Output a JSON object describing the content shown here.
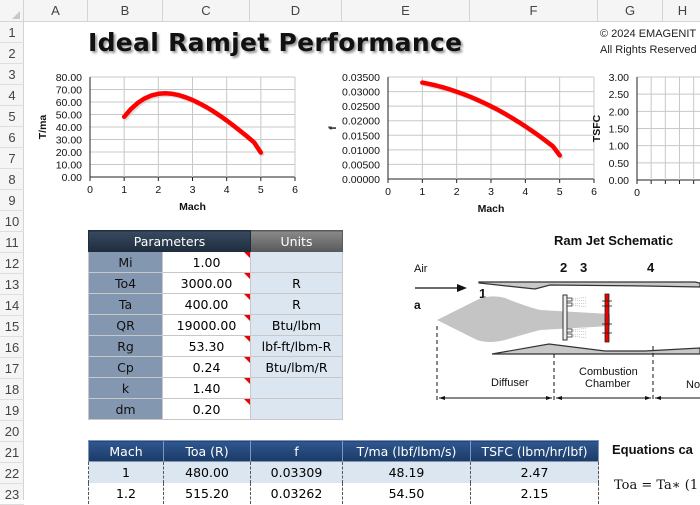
{
  "spreadsheet": {
    "columns": [
      "A",
      "B",
      "C",
      "D",
      "E",
      "F",
      "G",
      "H"
    ],
    "rows": [
      "1",
      "2",
      "3",
      "4",
      "5",
      "6",
      "7",
      "8",
      "9",
      "10",
      "11",
      "12",
      "13",
      "14",
      "15",
      "16",
      "17",
      "18",
      "19",
      "20",
      "21",
      "22",
      "23"
    ]
  },
  "header": {
    "title": "Ideal Ramjet Performance",
    "copyright_line1": "© 2024 EMAGENIT",
    "copyright_line2": "All Rights Reserved"
  },
  "parameters": {
    "header_params": "Parameters",
    "header_units": "Units",
    "rows": [
      {
        "name": "Mi",
        "value": "1.00",
        "unit": ""
      },
      {
        "name": "To4",
        "value": "3000.00",
        "unit": "R"
      },
      {
        "name": "Ta",
        "value": "400.00",
        "unit": "R"
      },
      {
        "name": "QR",
        "value": "19000.00",
        "unit": "Btu/lbm"
      },
      {
        "name": "Rg",
        "value": "53.30",
        "unit": "lbf-ft/lbm-R"
      },
      {
        "name": "Cp",
        "value": "0.24",
        "unit": "Btu/lbm/R"
      },
      {
        "name": "k",
        "value": "1.40",
        "unit": ""
      },
      {
        "name": "dm",
        "value": "0.20",
        "unit": ""
      }
    ]
  },
  "schematic": {
    "title": "Ram Jet Schematic",
    "air_label": "Air",
    "a_label": "a",
    "station_1": "1",
    "station_2": "2",
    "station_3": "3",
    "station_4": "4",
    "diffuser_label": "Diffuser",
    "combustion_label_1": "Combustion",
    "combustion_label_2": "Chamber",
    "nozzle_label": "No"
  },
  "results": {
    "headers": [
      "Mach",
      "Toa (R)",
      "f",
      "T/ma (lbf/lbm/s)",
      "TSFC (lbm/hr/lbf)"
    ],
    "rows": [
      [
        "1",
        "480.00",
        "0.03309",
        "48.19",
        "2.47"
      ],
      [
        "1.2",
        "515.20",
        "0.03262",
        "54.50",
        "2.15"
      ]
    ]
  },
  "equations": {
    "title": "Equations ca",
    "line1": "Toa  = Ta∗ (1"
  },
  "chart_data": [
    {
      "type": "line",
      "title": "",
      "xlabel": "Mach",
      "ylabel": "T/ma",
      "xlim": [
        0,
        6
      ],
      "ylim": [
        0,
        80
      ],
      "xticks": [
        "0",
        "1",
        "2",
        "3",
        "4",
        "5",
        "6"
      ],
      "yticks": [
        "0.00",
        "10.00",
        "20.00",
        "30.00",
        "40.00",
        "50.00",
        "60.00",
        "70.00",
        "80.00"
      ],
      "grid": true,
      "color": "#ff0000",
      "x": [
        1,
        1.2,
        1.4,
        1.6,
        1.8,
        2.0,
        2.2,
        2.4,
        2.6,
        2.8,
        3.0,
        3.2,
        3.4,
        3.6,
        3.8,
        4.0,
        4.2,
        4.4,
        4.6,
        4.8,
        5.0
      ],
      "y": [
        48.19,
        54.5,
        59.3,
        62.9,
        65.3,
        66.6,
        67.0,
        66.6,
        65.5,
        63.8,
        61.6,
        59.0,
        56.0,
        52.7,
        49.1,
        45.2,
        41.1,
        36.8,
        32.4,
        27.8,
        19.5
      ]
    },
    {
      "type": "line",
      "title": "",
      "xlabel": "Mach",
      "ylabel": "f",
      "xlim": [
        0,
        6
      ],
      "ylim": [
        0,
        0.035
      ],
      "xticks": [
        "0",
        "1",
        "2",
        "3",
        "4",
        "5",
        "6"
      ],
      "yticks": [
        "0.00000",
        "0.00500",
        "0.01000",
        "0.01500",
        "0.02000",
        "0.02500",
        "0.03000",
        "0.03500"
      ],
      "grid": true,
      "color": "#ff0000",
      "x": [
        1,
        1.2,
        1.4,
        1.6,
        1.8,
        2.0,
        2.2,
        2.4,
        2.6,
        2.8,
        3.0,
        3.2,
        3.4,
        3.6,
        3.8,
        4.0,
        4.2,
        4.4,
        4.6,
        4.8,
        5.0
      ],
      "y": [
        0.03309,
        0.03262,
        0.03207,
        0.03145,
        0.03075,
        0.02997,
        0.02912,
        0.02819,
        0.02719,
        0.02611,
        0.02496,
        0.02373,
        0.02243,
        0.02105,
        0.0196,
        0.01808,
        0.01648,
        0.01481,
        0.01307,
        0.01125,
        0.0081
      ]
    },
    {
      "type": "line",
      "title": "",
      "xlabel": "",
      "ylabel": "TSFC",
      "xlim": [
        0,
        6
      ],
      "ylim": [
        0,
        3
      ],
      "xticks": [
        "0"
      ],
      "yticks": [
        "0.00",
        "0.50",
        "1.00",
        "1.50",
        "2.00",
        "2.50",
        "3.00"
      ],
      "grid": true
    }
  ]
}
